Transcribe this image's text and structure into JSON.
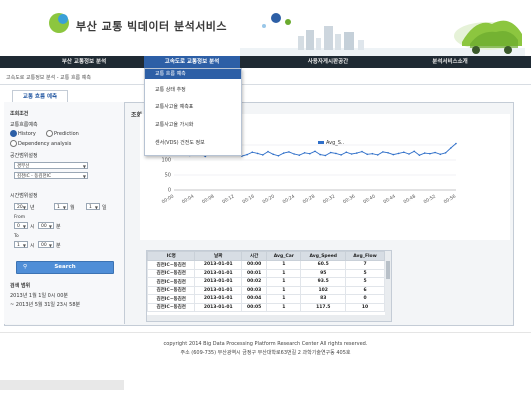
{
  "header": {
    "logo_letter": "B",
    "site_title": "부산 교통 빅데이터 분석서비스"
  },
  "nav": {
    "items": [
      "부산 교통정보 분석",
      "고속도로 교통정보 분석",
      "사용자게시판공간",
      "분석서비스소개"
    ]
  },
  "breadcrumb": "고속도로 교통정보 분석 - 교통 흐름 예측",
  "dropdown": {
    "items": [
      "교통 흐름 예측",
      "교통 상태 추정",
      "교통사고율 예측표",
      "교통사고율 가시화",
      "센서(VDS) 건전도 정보"
    ]
  },
  "tab_label": "교통 흐름 예측",
  "left_panel": {
    "condition_title": "조회조건",
    "algo_title": "교통흐름예측",
    "algo_options": [
      "History",
      "Prediction",
      "Dependency analysis"
    ],
    "space_title": "공간범위설정",
    "space_select_1": "경부선",
    "space_select_2": "김천IC - 동김천IC",
    "time_title": "시간범위설정",
    "time_row_1": [
      "20",
      "년",
      "1",
      "월",
      "1",
      "일"
    ],
    "from_label": "From",
    "from_row": [
      "0",
      "시",
      "00",
      "분"
    ],
    "to_label": "To",
    "to_row": [
      "1",
      "시",
      "00",
      "분"
    ],
    "search_label": "Search",
    "result_title": "검색 범위",
    "result_line_1": "2013년 1월 1일 0시 00분",
    "result_line_2": "~ 2013년 5월 31일 23시 58분"
  },
  "right_panel": {
    "title": "조회"
  },
  "chart_data": {
    "type": "line",
    "series": [
      {
        "name": "Avg_S..",
        "color": "#2f6fc9",
        "values": [
          126,
          118,
          122,
          115,
          128,
          120,
          112,
          124,
          119,
          127,
          116,
          121,
          125,
          113,
          118,
          126,
          122,
          117,
          128,
          119,
          114,
          123,
          127,
          120,
          116,
          124,
          121,
          129,
          118,
          115,
          125,
          122,
          117,
          126,
          120,
          123,
          128,
          119,
          121,
          117,
          127,
          124,
          118,
          122,
          126,
          120,
          129,
          116,
          123,
          121,
          125,
          119,
          124,
          140,
          155
        ]
      }
    ],
    "categories": [
      "00:00",
      "00:04",
      "00:08",
      "00:12",
      "00:16",
      "00:20",
      "00:24",
      "00:28",
      "00:32",
      "00:36",
      "00:40",
      "00:44",
      "00:48",
      "00:52",
      "00:56"
    ],
    "yticks": [
      0,
      50,
      100,
      150
    ],
    "ylim": [
      0,
      160
    ]
  },
  "table": {
    "headers": [
      "IC명",
      "날짜",
      "시간",
      "Avg_Car",
      "Avg_Speed",
      "Avg_Flow"
    ],
    "rows": [
      [
        "김천IC~동김천",
        "2013-01-01",
        "00:00",
        "1",
        "60.5",
        "7"
      ],
      [
        "김천IC~동김천",
        "2013-01-01",
        "00:01",
        "1",
        "95",
        "5"
      ],
      [
        "김천IC~동김천",
        "2013-01-01",
        "00:02",
        "1",
        "93.5",
        "5"
      ],
      [
        "김천IC~동김천",
        "2013-01-01",
        "00:03",
        "1",
        "102",
        "6"
      ],
      [
        "김천IC~동김천",
        "2013-01-01",
        "00:04",
        "1",
        "83",
        "0"
      ],
      [
        "김천IC~동김천",
        "2013-01-01",
        "00:05",
        "1",
        "117.5",
        "10"
      ]
    ]
  },
  "footer": {
    "line_1": "copyright 2014 Big Data Processing Platform Research Center All rights reserved.",
    "line_2": "주소 (609-735) 부산광역시 금정구 부산대학로63번길 2 과학기술연구동 405호"
  }
}
